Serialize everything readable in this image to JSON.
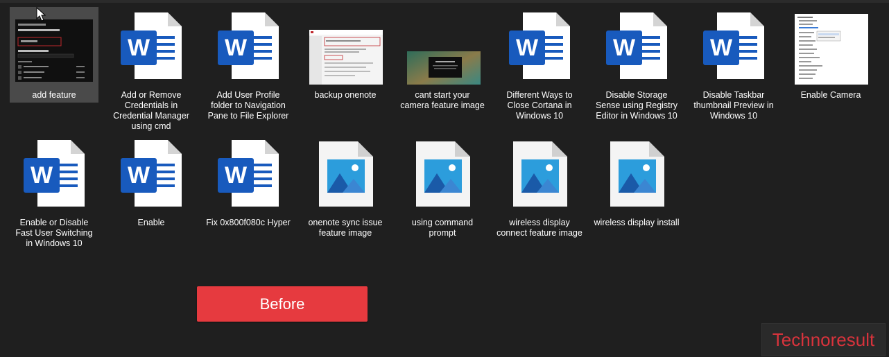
{
  "files": [
    {
      "name": "add feature",
      "type": "screenshot-add-feature",
      "selected": true
    },
    {
      "name": "Add or Remove Credentials in Credential Manager using cmd",
      "type": "word"
    },
    {
      "name": "Add User Profile folder to Navigation Pane to File Explorer",
      "type": "word"
    },
    {
      "name": "backup onenote",
      "type": "screenshot-backup"
    },
    {
      "name": "cant start your camera feature image",
      "type": "screenshot-camera"
    },
    {
      "name": "Different Ways to Close Cortana in Windows 10",
      "type": "word"
    },
    {
      "name": "Disable Storage Sense using Registry Editor in Windows 10",
      "type": "word"
    },
    {
      "name": "Disable Taskbar thumbnail Preview in Windows 10",
      "type": "word"
    },
    {
      "name": "Enable Camera",
      "type": "screenshot-device-manager"
    },
    {
      "name": "Enable or Disable Fast User Switching in Windows 10",
      "type": "word"
    },
    {
      "name": "Enable",
      "type": "word"
    },
    {
      "name": "Fix 0x800f080c Hyper",
      "type": "word"
    },
    {
      "name": "onenote sync issue feature image",
      "type": "image"
    },
    {
      "name": "using command prompt",
      "type": "image"
    },
    {
      "name": "wireless display connect feature image",
      "type": "image"
    },
    {
      "name": "wireless display install",
      "type": "image"
    }
  ],
  "before_button": {
    "label": "Before"
  },
  "watermark": {
    "text": "Technoresult"
  },
  "colors": {
    "background": "#1f1f1f",
    "word_blue": "#185abd",
    "button_red": "#e63a3f",
    "watermark_red": "#d8333c"
  }
}
